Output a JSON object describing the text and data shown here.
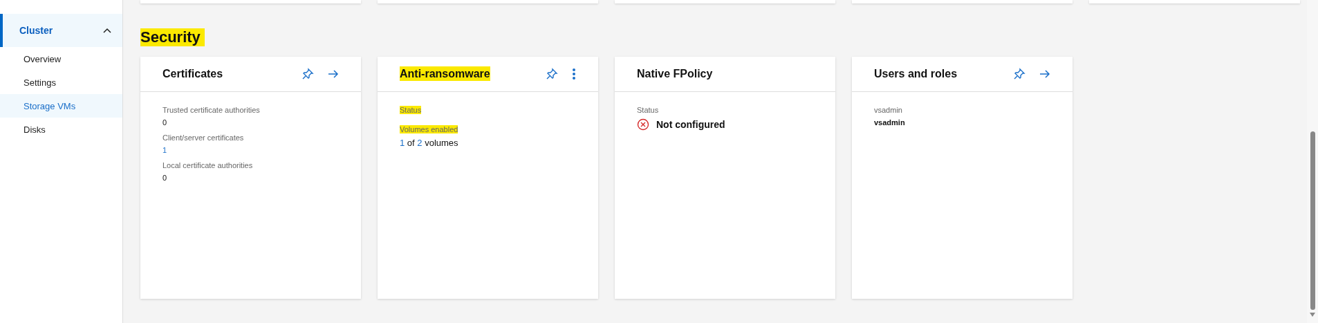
{
  "sidebar": {
    "items": [
      {
        "label": "Cluster",
        "expanded": true,
        "selected": true,
        "children": [
          {
            "label": "Overview",
            "selected": false
          },
          {
            "label": "Settings",
            "selected": false
          },
          {
            "label": "Storage VMs",
            "selected": true
          },
          {
            "label": "Disks",
            "selected": false
          }
        ]
      }
    ]
  },
  "section": {
    "title": "Security",
    "highlighted": true
  },
  "cards": [
    {
      "title": "Certificates",
      "highlighted": false,
      "actions": [
        {
          "kind": "pin"
        },
        {
          "kind": "arrow"
        }
      ],
      "fields": [
        {
          "label": "Trusted certificate authorities",
          "highlighted": false,
          "value": [
            {
              "text": "0",
              "link": false
            }
          ]
        },
        {
          "label": "Client/server certificates",
          "highlighted": false,
          "value": [
            {
              "text": "1",
              "link": true
            }
          ]
        },
        {
          "label": "Local certificate authorities",
          "highlighted": false,
          "value": [
            {
              "text": "0",
              "link": false
            }
          ]
        }
      ]
    },
    {
      "title": "Anti-ransomware",
      "highlighted": true,
      "actions": [
        {
          "kind": "pin"
        },
        {
          "kind": "more"
        }
      ],
      "fields": [
        {
          "label": "Status",
          "highlighted": true
        },
        {
          "label": "Volumes enabled",
          "highlighted": true,
          "value": [
            {
              "text": "1",
              "link": true
            },
            {
              "text": " of ",
              "link": false
            },
            {
              "text": "2",
              "link": true
            },
            {
              "text": " volumes",
              "link": false
            }
          ],
          "large": true
        }
      ]
    },
    {
      "title": "Native FPolicy",
      "highlighted": false,
      "fields": [
        {
          "label": "Status",
          "highlighted": false,
          "configured": false,
          "status_text": "Not configured"
        }
      ]
    },
    {
      "title": "Users and roles",
      "highlighted": false,
      "actions": [
        {
          "kind": "pin"
        },
        {
          "kind": "arrow"
        }
      ],
      "fields": [
        {
          "label": "vsadmin",
          "highlighted": false,
          "value": [
            {
              "text": "vsadmin",
              "link": false
            }
          ],
          "bold": true
        }
      ]
    }
  ]
}
